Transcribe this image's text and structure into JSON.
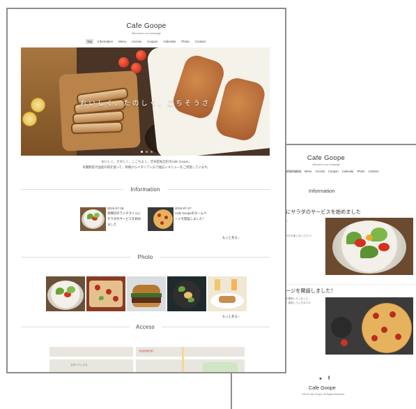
{
  "front": {
    "site_title": "Cafe Goope",
    "site_subtitle": "Welcome to our homepage",
    "nav": [
      "Top",
      "Information",
      "Menu",
      "Access",
      "Coupon",
      "Calendar",
      "Photo",
      "Contact"
    ],
    "nav_active": "Top",
    "hero_text": "おいしく、たのしく、ごちそうさ",
    "intro_line1": "おいしく、たのしく、ここちよく。渋谷区桜丘町のCafe Goope。",
    "intro_line2": "有機野菜や国産の肉を使って、和風からイタリアンまで幅広いメニューをご用意しています。",
    "sections": {
      "information": "Information",
      "photo": "Photo",
      "access": "Access"
    },
    "posts": [
      {
        "date": "2015-07-28",
        "title_lines": [
          "金曜日のランチタイムに",
          "サラダのサービスを始め",
          "ました"
        ]
      },
      {
        "date": "2015-07-27",
        "title_lines": [
          "Cafe Goopeのホームペ",
          "ージを開設しました！"
        ]
      }
    ],
    "more_label": "もっと見る ›",
    "map_labels": [
      "渋谷区桜丘町",
      "スターバックス"
    ]
  },
  "back": {
    "site_title": "Cafe Goope",
    "site_subtitle": "Welcome to our homepage",
    "nav": [
      "Information",
      "Menu",
      "Access",
      "Coupon",
      "Calendar",
      "Photo",
      "Contact"
    ],
    "nav_active": "Information",
    "section_title": "Information",
    "posts": [
      {
        "title": "にサラダのサービスを始めました",
        "snippet_lines": [
          "へ",
          "サをお楽しみください!"
        ]
      },
      {
        "title": "ージを開設しました！",
        "snippet_lines": [
          "を開設いたしました。",
          "に更新していきますの"
        ]
      }
    ],
    "footer": {
      "social": [
        "twitter-icon",
        "facebook-icon"
      ],
      "title": "Cafe Goope",
      "copyright": "©2015 Cafe Goope. All Rights Reserved."
    }
  }
}
